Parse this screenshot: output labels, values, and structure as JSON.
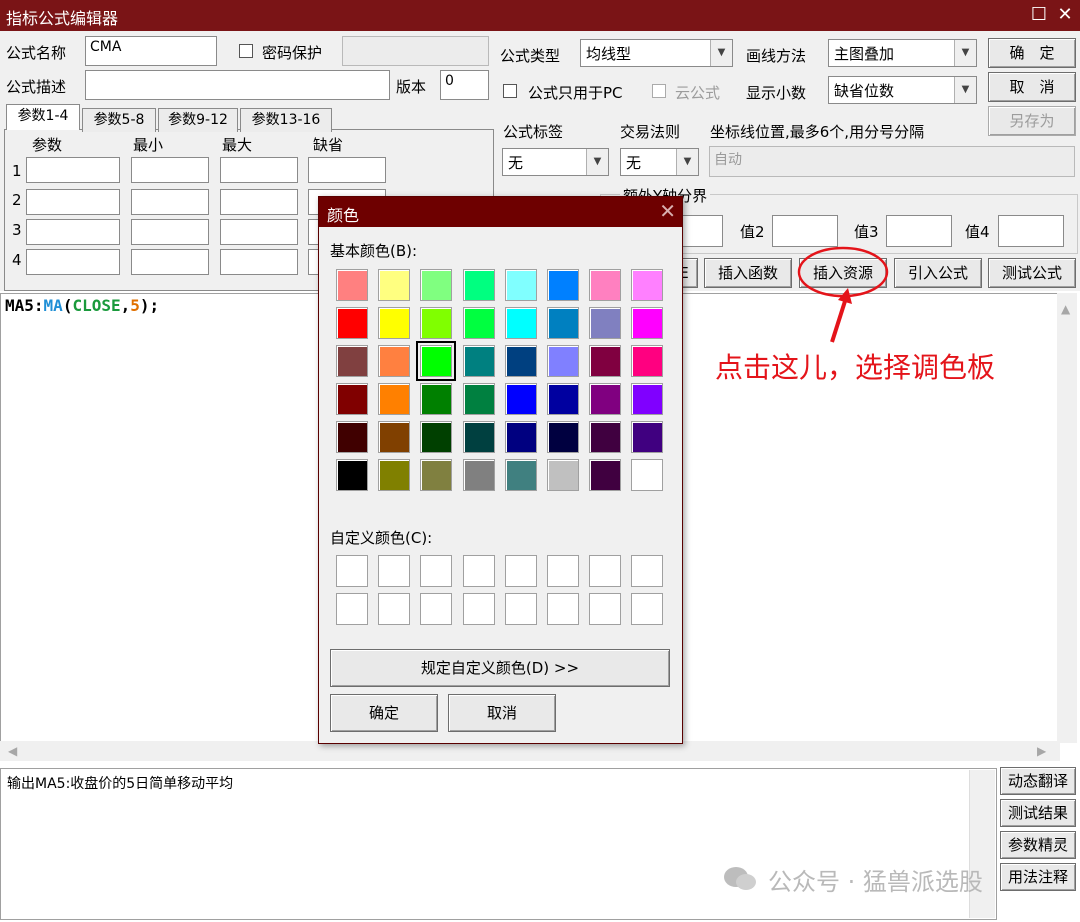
{
  "window": {
    "title": "指标公式编辑器",
    "maximize_glyph": "☐",
    "close_glyph": "✕"
  },
  "form": {
    "name_label": "公式名称",
    "name_value": "CMA",
    "password_label": "密码保护",
    "desc_label": "公式描述",
    "desc_value": "",
    "version_label": "版本",
    "version_value": "0",
    "type_label": "公式类型",
    "type_value": "均线型",
    "draw_label": "画线方法",
    "draw_value": "主图叠加",
    "pc_only_label": "公式只用于PC",
    "cloud_label": "云公式",
    "decimal_label": "显示小数",
    "decimal_value": "缺省位数",
    "tag_label": "公式标签",
    "tag_value": "无",
    "trade_label": "交易法则",
    "trade_value": "无",
    "coord_label": "坐标线位置,最多6个,用分号分隔",
    "coord_value": "自动",
    "axis_group_label": "额外Y轴分界",
    "val2": "值2",
    "val3": "值3",
    "val4": "值4"
  },
  "tabs": [
    "参数1-4",
    "参数5-8",
    "参数9-12",
    "参数13-16"
  ],
  "param_headers": [
    "参数",
    "最小",
    "最大",
    "缺省"
  ],
  "param_rows": [
    "1",
    "2",
    "3",
    "4"
  ],
  "buttons": {
    "ok": "确　定",
    "cancel": "取　消",
    "save_as": "另存为",
    "insert_func": "插入函数",
    "insert_res": "插入资源",
    "import": "引入公式",
    "test": "测试公式",
    "partial": "E"
  },
  "code": {
    "name": "MA5",
    "colon": ":",
    "func": "MA",
    "open": "(",
    "arg": "CLOSE",
    "comma": ",",
    "num": "5",
    "close": ");"
  },
  "status_text": "输出MA5:收盘价的5日简单移动平均",
  "side_buttons": [
    "动态翻译",
    "测试结果",
    "参数精灵",
    "用法注释"
  ],
  "annotation": "点击这儿，选择调色板",
  "watermark": "公众号 · 猛兽派选股",
  "dialog": {
    "title": "颜色",
    "close_glyph": "✕",
    "basic_label": "基本颜色(B):",
    "custom_label": "自定义颜色(C):",
    "define_button": "规定自定义颜色(D) >>",
    "ok": "确定",
    "cancel": "取消",
    "colors": [
      [
        "#FF8080",
        "#FFFF80",
        "#80FF80",
        "#00FF80",
        "#80FFFF",
        "#0080FF",
        "#FF80C0",
        "#FF80FF"
      ],
      [
        "#FF0000",
        "#FFFF00",
        "#80FF00",
        "#00FF40",
        "#00FFFF",
        "#0080C0",
        "#8080C0",
        "#FF00FF"
      ],
      [
        "#804040",
        "#FF8040",
        "#00FF00",
        "#008080",
        "#004080",
        "#8080FF",
        "#800040",
        "#FF0080"
      ],
      [
        "#800000",
        "#FF8000",
        "#008000",
        "#008040",
        "#0000FF",
        "#0000A0",
        "#800080",
        "#8000FF"
      ],
      [
        "#400000",
        "#804000",
        "#004000",
        "#004040",
        "#000080",
        "#000040",
        "#400040",
        "#400080"
      ],
      [
        "#000000",
        "#808000",
        "#808040",
        "#808080",
        "#408080",
        "#C0C0C0",
        "#400040",
        "#FFFFFF"
      ]
    ],
    "selected": "#00FF00"
  }
}
